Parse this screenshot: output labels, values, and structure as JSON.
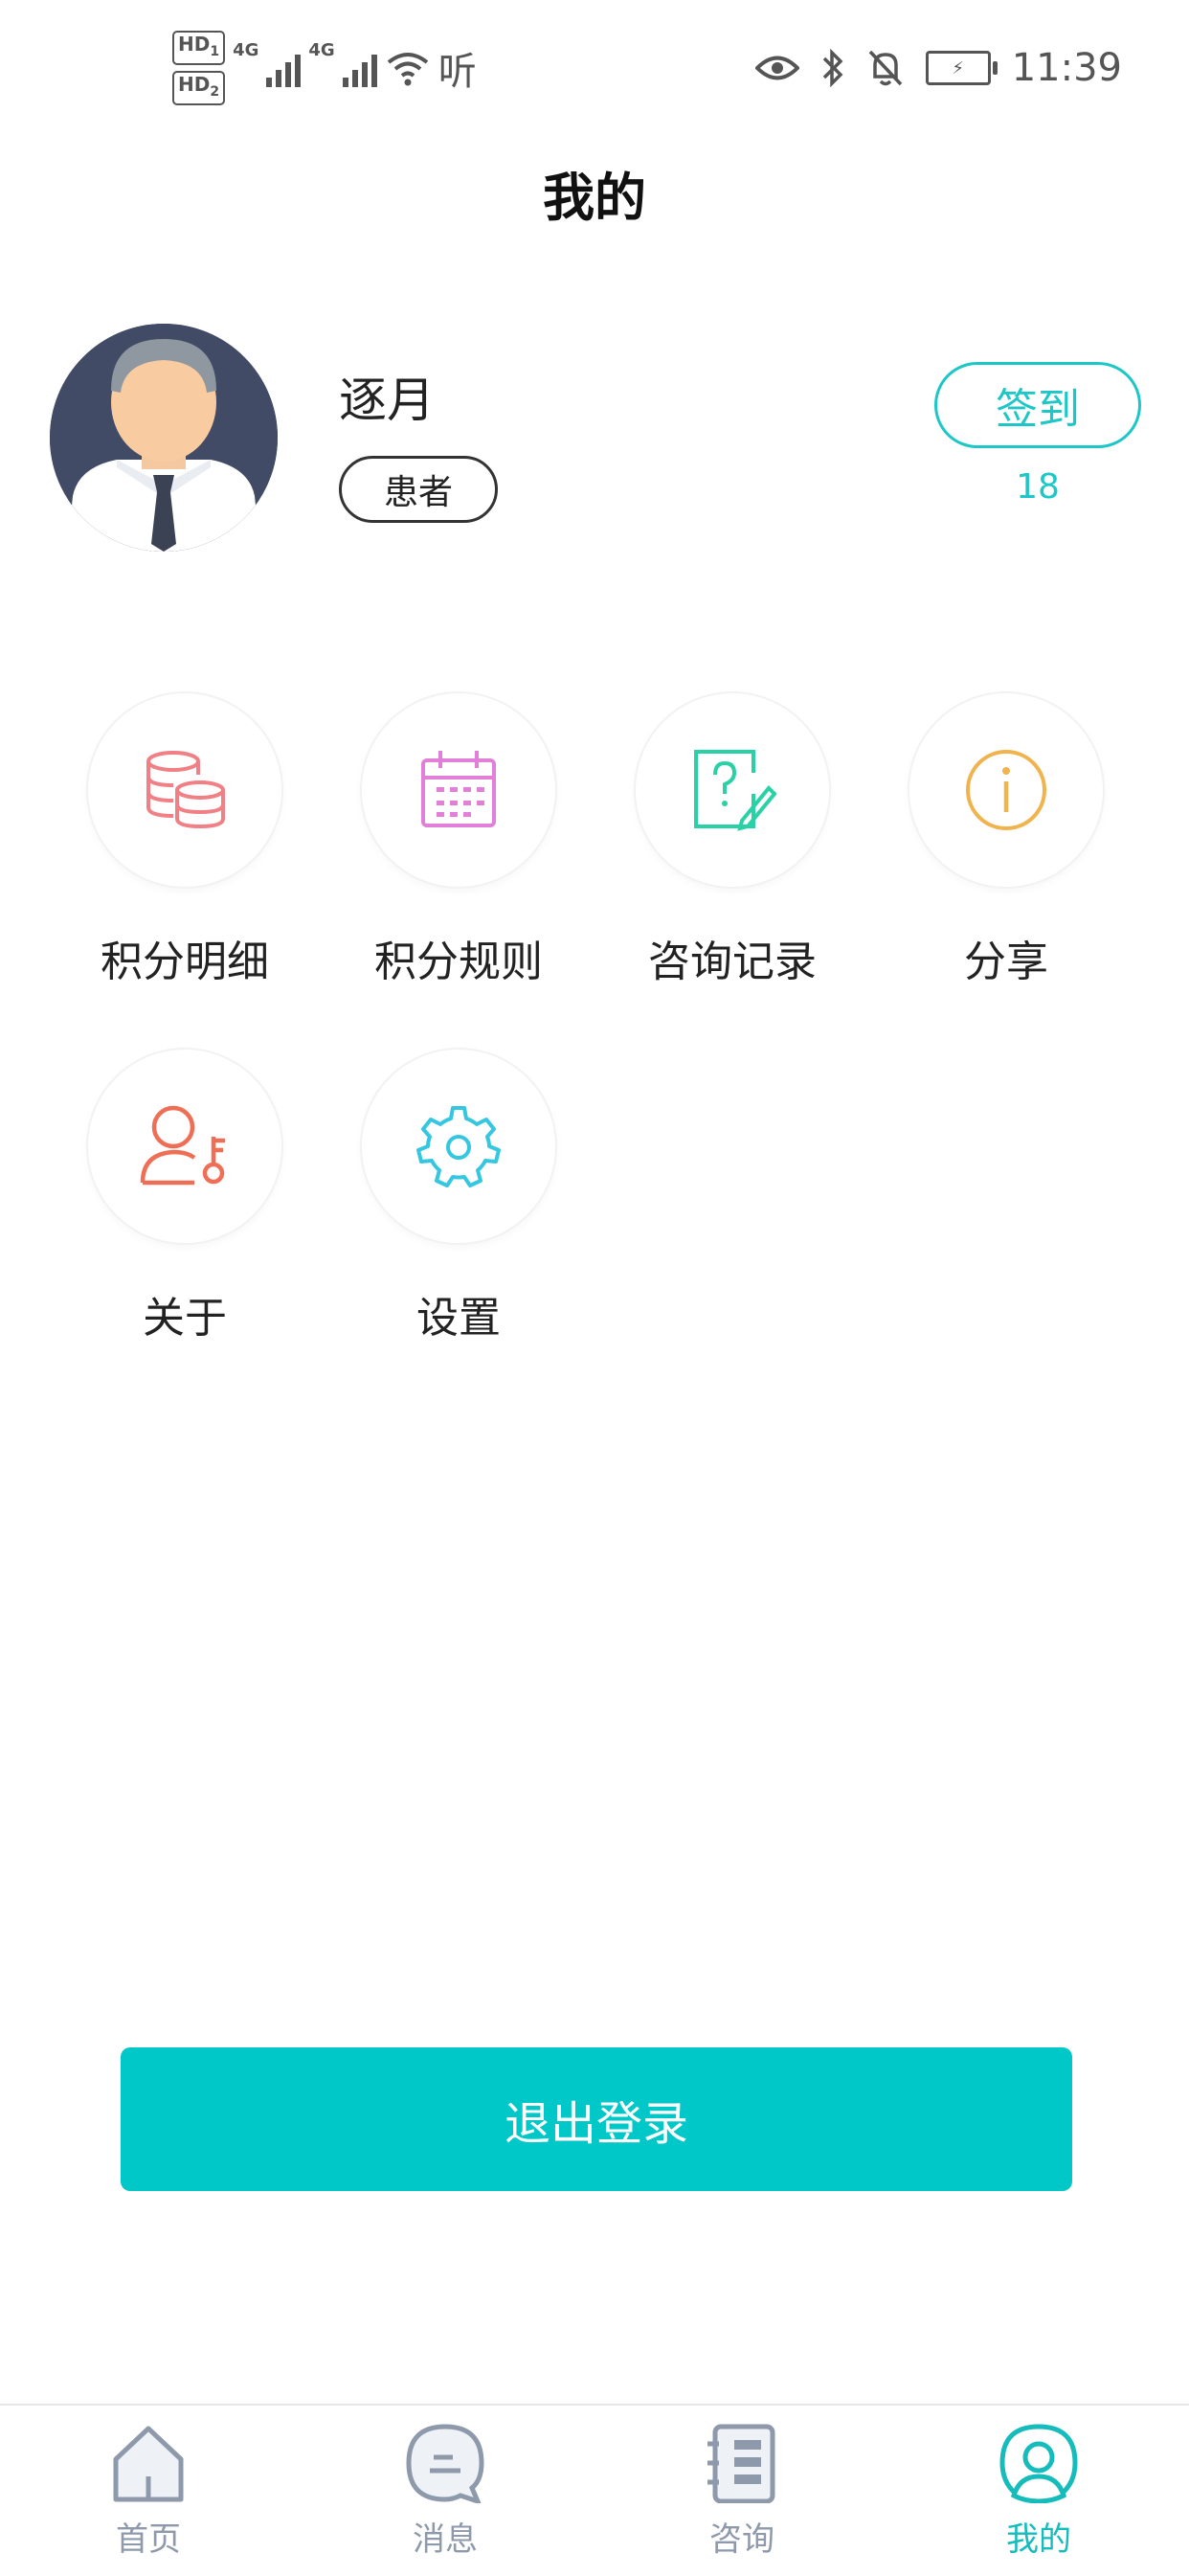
{
  "status_bar": {
    "hd1": "HD",
    "hd1_sub": "1",
    "hd2": "HD",
    "hd2_sub": "2",
    "net1": "4G",
    "net2": "4G",
    "listen_icon_text": "听",
    "time": "11:39",
    "icons": [
      "eye-icon",
      "bluetooth-icon",
      "mute-bell-icon",
      "battery-icon"
    ]
  },
  "header": {
    "title": "我的"
  },
  "profile": {
    "name": "逐月",
    "role": "患者",
    "checkin_label": "签到",
    "checkin_count": "18"
  },
  "menu": {
    "items": [
      {
        "label": "积分明细",
        "icon": "coins-stack-icon",
        "color": "#f07f86"
      },
      {
        "label": "积分规则",
        "icon": "calendar-icon",
        "color": "#e27fd8"
      },
      {
        "label": "咨询记录",
        "icon": "question-edit-icon",
        "color": "#2ad1a6"
      },
      {
        "label": "分享",
        "icon": "info-circle-icon",
        "color": "#f0b34d"
      },
      {
        "label": "关于",
        "icon": "user-key-icon",
        "color": "#ef6f56"
      },
      {
        "label": "设置",
        "icon": "gear-icon",
        "color": "#35c6e0"
      }
    ]
  },
  "logout": {
    "label": "退出登录"
  },
  "tabbar": {
    "items": [
      {
        "label": "首页",
        "icon": "home-icon",
        "active": false
      },
      {
        "label": "消息",
        "icon": "message-icon",
        "active": false
      },
      {
        "label": "咨询",
        "icon": "notebook-icon",
        "active": false
      },
      {
        "label": "我的",
        "icon": "profile-icon",
        "active": true
      }
    ]
  },
  "colors": {
    "accent": "#00c8c8",
    "tab_inactive": "#8e9aab",
    "tab_active": "#16bcbc"
  }
}
